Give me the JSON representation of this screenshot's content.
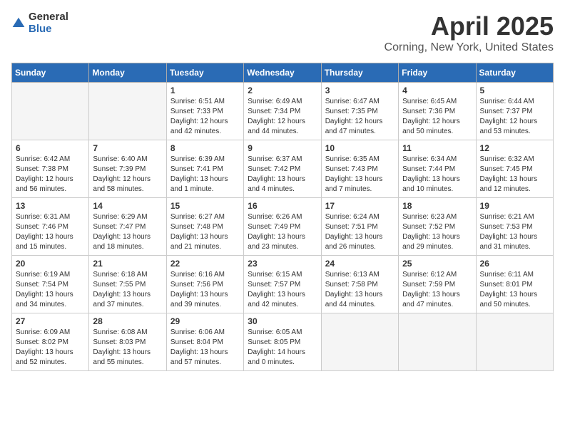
{
  "header": {
    "logo_general": "General",
    "logo_blue": "Blue",
    "title": "April 2025",
    "subtitle": "Corning, New York, United States"
  },
  "days_of_week": [
    "Sunday",
    "Monday",
    "Tuesday",
    "Wednesday",
    "Thursday",
    "Friday",
    "Saturday"
  ],
  "weeks": [
    [
      {
        "day": "",
        "sunrise": "",
        "sunset": "",
        "daylight": ""
      },
      {
        "day": "",
        "sunrise": "",
        "sunset": "",
        "daylight": ""
      },
      {
        "day": "1",
        "sunrise": "Sunrise: 6:51 AM",
        "sunset": "Sunset: 7:33 PM",
        "daylight": "Daylight: 12 hours and 42 minutes."
      },
      {
        "day": "2",
        "sunrise": "Sunrise: 6:49 AM",
        "sunset": "Sunset: 7:34 PM",
        "daylight": "Daylight: 12 hours and 44 minutes."
      },
      {
        "day": "3",
        "sunrise": "Sunrise: 6:47 AM",
        "sunset": "Sunset: 7:35 PM",
        "daylight": "Daylight: 12 hours and 47 minutes."
      },
      {
        "day": "4",
        "sunrise": "Sunrise: 6:45 AM",
        "sunset": "Sunset: 7:36 PM",
        "daylight": "Daylight: 12 hours and 50 minutes."
      },
      {
        "day": "5",
        "sunrise": "Sunrise: 6:44 AM",
        "sunset": "Sunset: 7:37 PM",
        "daylight": "Daylight: 12 hours and 53 minutes."
      }
    ],
    [
      {
        "day": "6",
        "sunrise": "Sunrise: 6:42 AM",
        "sunset": "Sunset: 7:38 PM",
        "daylight": "Daylight: 12 hours and 56 minutes."
      },
      {
        "day": "7",
        "sunrise": "Sunrise: 6:40 AM",
        "sunset": "Sunset: 7:39 PM",
        "daylight": "Daylight: 12 hours and 58 minutes."
      },
      {
        "day": "8",
        "sunrise": "Sunrise: 6:39 AM",
        "sunset": "Sunset: 7:41 PM",
        "daylight": "Daylight: 13 hours and 1 minute."
      },
      {
        "day": "9",
        "sunrise": "Sunrise: 6:37 AM",
        "sunset": "Sunset: 7:42 PM",
        "daylight": "Daylight: 13 hours and 4 minutes."
      },
      {
        "day": "10",
        "sunrise": "Sunrise: 6:35 AM",
        "sunset": "Sunset: 7:43 PM",
        "daylight": "Daylight: 13 hours and 7 minutes."
      },
      {
        "day": "11",
        "sunrise": "Sunrise: 6:34 AM",
        "sunset": "Sunset: 7:44 PM",
        "daylight": "Daylight: 13 hours and 10 minutes."
      },
      {
        "day": "12",
        "sunrise": "Sunrise: 6:32 AM",
        "sunset": "Sunset: 7:45 PM",
        "daylight": "Daylight: 13 hours and 12 minutes."
      }
    ],
    [
      {
        "day": "13",
        "sunrise": "Sunrise: 6:31 AM",
        "sunset": "Sunset: 7:46 PM",
        "daylight": "Daylight: 13 hours and 15 minutes."
      },
      {
        "day": "14",
        "sunrise": "Sunrise: 6:29 AM",
        "sunset": "Sunset: 7:47 PM",
        "daylight": "Daylight: 13 hours and 18 minutes."
      },
      {
        "day": "15",
        "sunrise": "Sunrise: 6:27 AM",
        "sunset": "Sunset: 7:48 PM",
        "daylight": "Daylight: 13 hours and 21 minutes."
      },
      {
        "day": "16",
        "sunrise": "Sunrise: 6:26 AM",
        "sunset": "Sunset: 7:49 PM",
        "daylight": "Daylight: 13 hours and 23 minutes."
      },
      {
        "day": "17",
        "sunrise": "Sunrise: 6:24 AM",
        "sunset": "Sunset: 7:51 PM",
        "daylight": "Daylight: 13 hours and 26 minutes."
      },
      {
        "day": "18",
        "sunrise": "Sunrise: 6:23 AM",
        "sunset": "Sunset: 7:52 PM",
        "daylight": "Daylight: 13 hours and 29 minutes."
      },
      {
        "day": "19",
        "sunrise": "Sunrise: 6:21 AM",
        "sunset": "Sunset: 7:53 PM",
        "daylight": "Daylight: 13 hours and 31 minutes."
      }
    ],
    [
      {
        "day": "20",
        "sunrise": "Sunrise: 6:19 AM",
        "sunset": "Sunset: 7:54 PM",
        "daylight": "Daylight: 13 hours and 34 minutes."
      },
      {
        "day": "21",
        "sunrise": "Sunrise: 6:18 AM",
        "sunset": "Sunset: 7:55 PM",
        "daylight": "Daylight: 13 hours and 37 minutes."
      },
      {
        "day": "22",
        "sunrise": "Sunrise: 6:16 AM",
        "sunset": "Sunset: 7:56 PM",
        "daylight": "Daylight: 13 hours and 39 minutes."
      },
      {
        "day": "23",
        "sunrise": "Sunrise: 6:15 AM",
        "sunset": "Sunset: 7:57 PM",
        "daylight": "Daylight: 13 hours and 42 minutes."
      },
      {
        "day": "24",
        "sunrise": "Sunrise: 6:13 AM",
        "sunset": "Sunset: 7:58 PM",
        "daylight": "Daylight: 13 hours and 44 minutes."
      },
      {
        "day": "25",
        "sunrise": "Sunrise: 6:12 AM",
        "sunset": "Sunset: 7:59 PM",
        "daylight": "Daylight: 13 hours and 47 minutes."
      },
      {
        "day": "26",
        "sunrise": "Sunrise: 6:11 AM",
        "sunset": "Sunset: 8:01 PM",
        "daylight": "Daylight: 13 hours and 50 minutes."
      }
    ],
    [
      {
        "day": "27",
        "sunrise": "Sunrise: 6:09 AM",
        "sunset": "Sunset: 8:02 PM",
        "daylight": "Daylight: 13 hours and 52 minutes."
      },
      {
        "day": "28",
        "sunrise": "Sunrise: 6:08 AM",
        "sunset": "Sunset: 8:03 PM",
        "daylight": "Daylight: 13 hours and 55 minutes."
      },
      {
        "day": "29",
        "sunrise": "Sunrise: 6:06 AM",
        "sunset": "Sunset: 8:04 PM",
        "daylight": "Daylight: 13 hours and 57 minutes."
      },
      {
        "day": "30",
        "sunrise": "Sunrise: 6:05 AM",
        "sunset": "Sunset: 8:05 PM",
        "daylight": "Daylight: 14 hours and 0 minutes."
      },
      {
        "day": "",
        "sunrise": "",
        "sunset": "",
        "daylight": ""
      },
      {
        "day": "",
        "sunrise": "",
        "sunset": "",
        "daylight": ""
      },
      {
        "day": "",
        "sunrise": "",
        "sunset": "",
        "daylight": ""
      }
    ]
  ]
}
